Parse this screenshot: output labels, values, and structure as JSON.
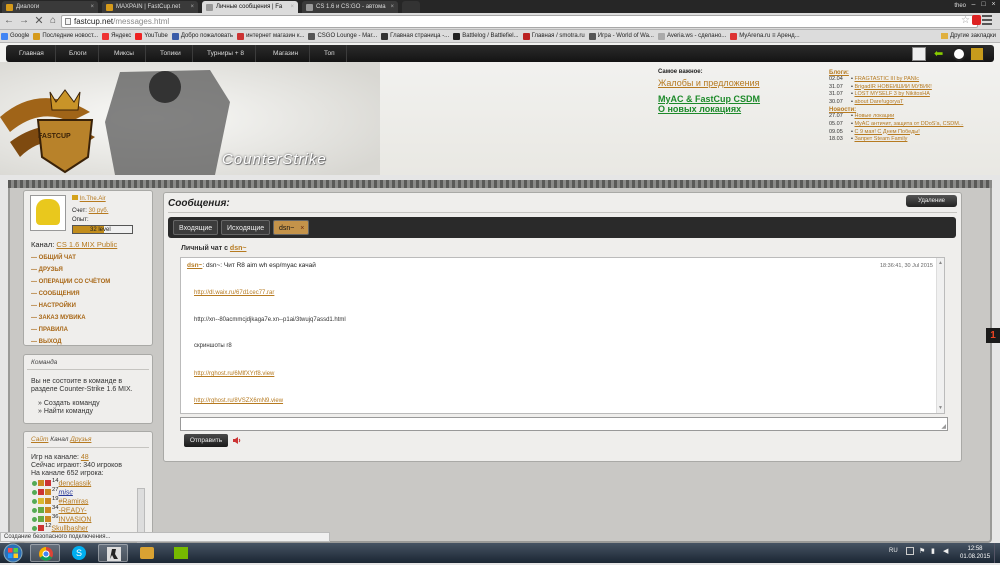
{
  "browser": {
    "tabs": [
      {
        "label": "Диалоги",
        "active": false
      },
      {
        "label": "MAXPAIN | FastCup.net",
        "active": false
      },
      {
        "label": "Личные сообщения | Fa",
        "active": true
      },
      {
        "label": "CS 1.6 и CS:GO - автома",
        "active": false
      }
    ],
    "profile": "theo",
    "url_host": "fastcup.net",
    "url_path": "/messages.html",
    "bookmarks": [
      "Google",
      "Последние новост...",
      "Яндекс",
      "YouTube",
      "Добро пожаловать",
      "интернет магазин к...",
      "CSGO Lounge - Mar...",
      "Главная страница -...",
      "Battlelog / Battlefiel...",
      "Главная / smotra.ru",
      "Игра - World of Wa...",
      "Averia.ws - сделано...",
      "MyArena.ru ≡ Аренд..."
    ],
    "other_bookmarks": "Другие закладки",
    "status": "Создание безопасного подключения..."
  },
  "site": {
    "nav": [
      "Главная",
      "Блоги",
      "Миксы",
      "Топики",
      "Турниры + 8",
      "Магазин",
      "Топ"
    ],
    "banner_text": "CounterStrike",
    "logo_text": "FASTCUP",
    "important": {
      "title": "Самое важное:",
      "links": [
        "Жалобы и предложения",
        "MyAC & FastCup CSDM",
        "О новых локациях"
      ]
    },
    "blogs": {
      "title": "Блоги:",
      "items": [
        {
          "date": "02.04",
          "text": "FRAGTASTIC III by PANIc"
        },
        {
          "date": "31.07",
          "text": "BrigadIR НОВЕЙШИЙ МУВИК!"
        },
        {
          "date": "31.07",
          "text": "LOST MYSELF 3 by NikitosHA"
        },
        {
          "date": "30.07",
          "text": "about Dare!ugoryaT"
        }
      ],
      "news_title": "Новости:",
      "news": [
        {
          "date": "27.07",
          "text": "Новые локации"
        },
        {
          "date": "05.07",
          "text": "MyAC античит, защита от DDoS'а, CSDM..."
        },
        {
          "date": "09.05",
          "text": "С 9 мая! С Днем Победы!"
        },
        {
          "date": "18.03",
          "text": "Запрет Steam Family"
        }
      ]
    }
  },
  "user": {
    "name": "In.The.Air",
    "balance_label": "Счет:",
    "balance": "30 руб.",
    "exp_label": "Опыт:",
    "level": "32 level",
    "level_progress": 0.52,
    "channel_label": "Канал:",
    "channel": "CS 1.6 MIX Public",
    "menu": [
      "— ОБЩИЙ ЧАТ",
      "— ДРУЗЬЯ",
      "— ОПЕРАЦИИ СО СЧЁТОМ",
      "— СООБЩЕНИЯ",
      "— НАСТРОЙКИ",
      "— ЗАКАЗ МУВИКА",
      "— ПРАВИЛА",
      "— ВЫХОД"
    ]
  },
  "team": {
    "header": "Команда",
    "text1": "Вы не состоите в команде в",
    "text2": "разделе Counter-Strike 1.6 MIX.",
    "create": "Создать команду",
    "find": "Найти команду"
  },
  "channel_box": {
    "site": "Сайт",
    "channel": "Канал",
    "friends": "Друзья",
    "stat1_label": "Игр на канале:",
    "stat1_value": "48",
    "stat2": "Сейчас играют: 340 игроков",
    "stat3": "На канале 652 игрока:",
    "players": [
      "denclassik",
      "misc",
      "#Ramiras",
      "-READY-",
      "INVASION",
      "Skullbasher"
    ],
    "player_levels": [
      "14",
      "27",
      "19",
      "34",
      "36",
      "12"
    ]
  },
  "messages": {
    "title": "Сообщения:",
    "delete": "Удаление",
    "tabs": [
      "Входящие",
      "Исходящие",
      "dsn~"
    ],
    "chat_title_prefix": "Личный чат с",
    "chat_with": "dsn~",
    "sender": "dsn~",
    "first_message": ": dsn~: Чит R8 aim wh esp/myac качай",
    "time": "18:36:41, 30 Jul 2015",
    "lines": [
      {
        "text": "http://dl.waix.ru/67d1cec77.rar",
        "link": true
      },
      {
        "text": "http://xn--80acmmcjdjkaga7e.xn--p1ai/3twujq7assd1.html",
        "link": false
      },
      {
        "text": "скриншоты r8",
        "link": false
      },
      {
        "text": "http://rghost.ru/6MlfXYrf8.view",
        "link": true
      },
      {
        "text": "http://rghost.ru/8VSZX6mN9.view",
        "link": true
      }
    ],
    "send": "Отправить",
    "side_tab": "1"
  },
  "taskbar": {
    "lang": "RU",
    "time": "12:58",
    "date": "01.08.2015"
  },
  "colors": {
    "accent": "#b67a20",
    "dark": "#2a2a2a",
    "green": "#1d8a2a"
  }
}
